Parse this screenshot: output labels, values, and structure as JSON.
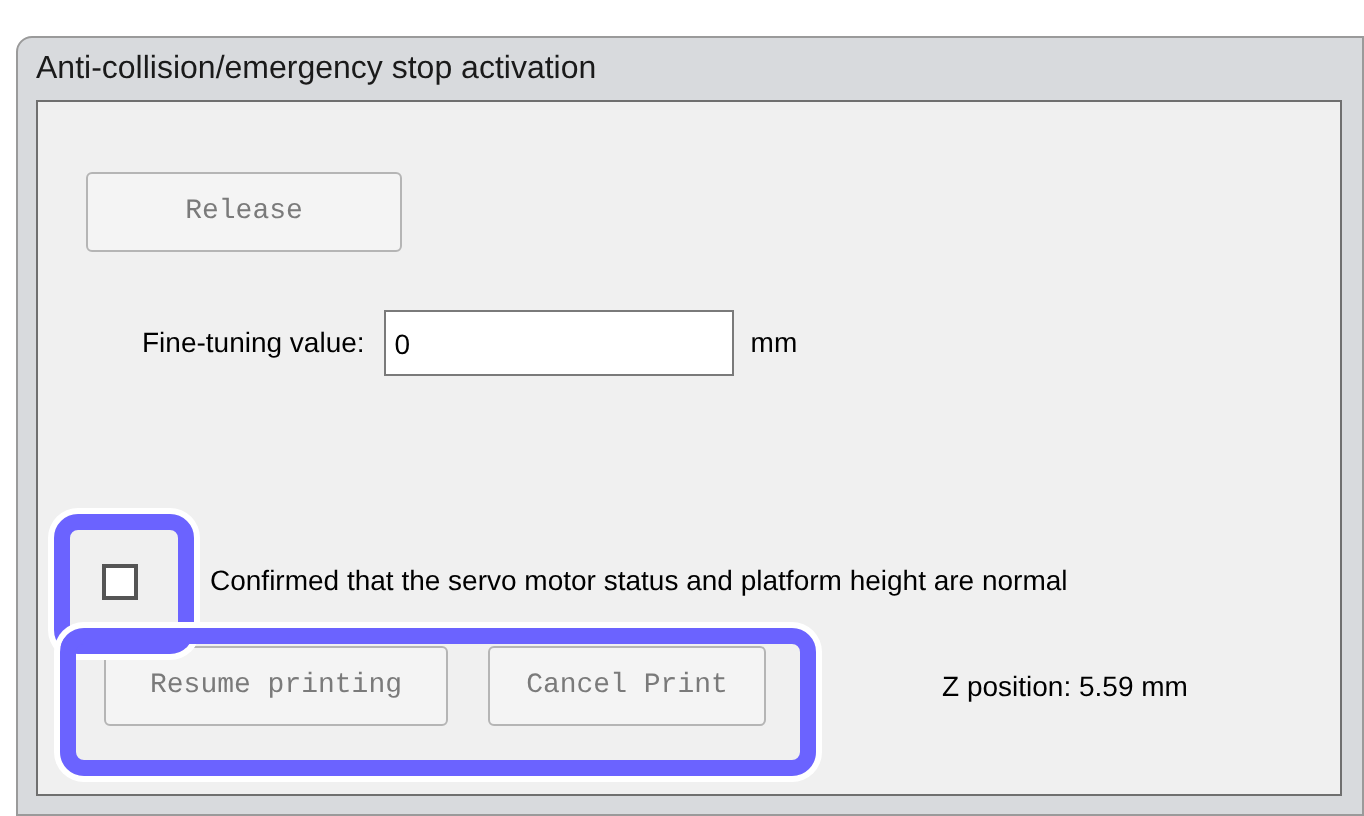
{
  "window": {
    "title": "Anti-collision/emergency stop activation"
  },
  "release_button": {
    "label": "Release",
    "disabled": true
  },
  "fine_tuning": {
    "label": "Fine-tuning value:",
    "value": "0",
    "unit": "mm"
  },
  "confirm": {
    "label": "Confirmed that the servo motor status and platform height are normal",
    "checked": false
  },
  "buttons": [
    {
      "label": "Resume printing",
      "disabled": true
    },
    {
      "label": "Cancel Print",
      "disabled": true
    }
  ],
  "z_position": "Z position: 5.59 mm"
}
